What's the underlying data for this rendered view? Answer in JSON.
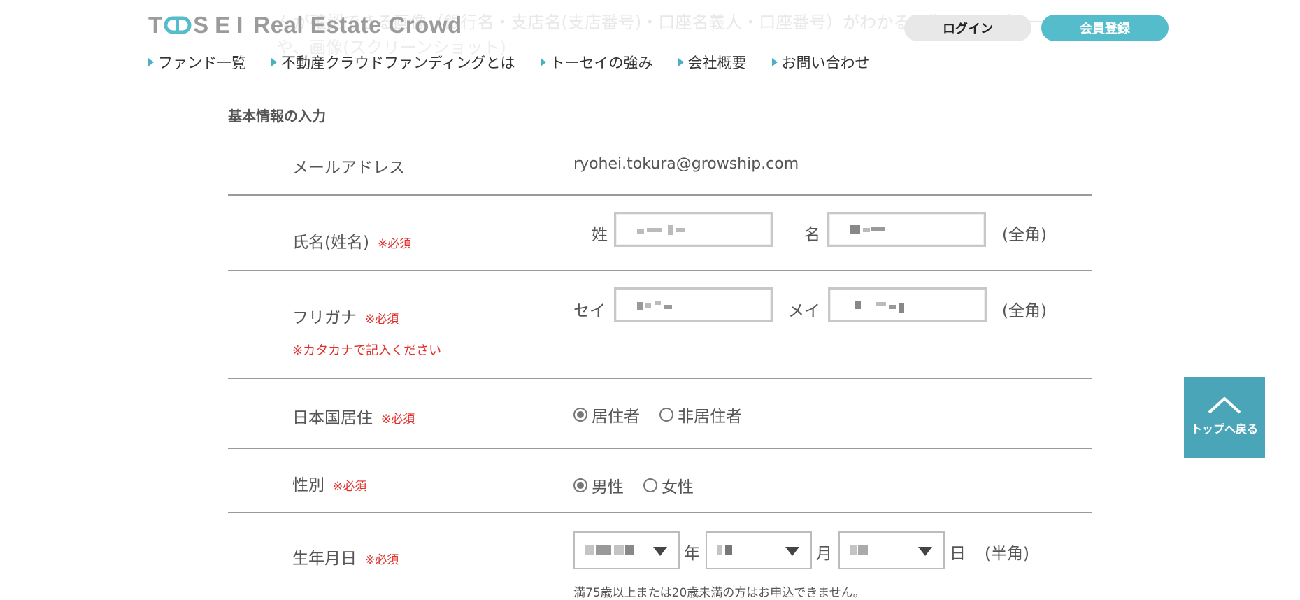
{
  "header": {
    "logo": "TOSEI Real Estate Crowd",
    "logo_parts": {
      "t": "T",
      "sei": "SEI",
      "rest": "Real Estate Crowd"
    },
    "login_label": "ログイン",
    "register_label": "会員登録",
    "nav": [
      {
        "label": "ファンド一覧"
      },
      {
        "label": "不動産クラウドファンディングとは"
      },
      {
        "label": "トーセイの強み"
      },
      {
        "label": "会社概要"
      },
      {
        "label": "お問い合わせ"
      }
    ]
  },
  "background_text": {
    "line1": "んが確認できる画像（銀行名・支店名(支店番号)・口座名義人・口座番号）がわかる画像をアップロード",
    "line2": "や、画像(スクリーンショット)"
  },
  "form": {
    "section_title": "基本情報の入力",
    "required": "※必須",
    "email": {
      "label": "メールアドレス",
      "value": "ryohei.tokura@growship.com"
    },
    "name": {
      "label": "氏名(姓名)",
      "sei_label": "姓",
      "mei_label": "名",
      "suffix": "(全角)"
    },
    "kana": {
      "label": "フリガナ",
      "note": "※カタカナで記入ください",
      "sei_label": "セイ",
      "mei_label": "メイ",
      "suffix": "(全角)"
    },
    "residence": {
      "label": "日本国居住",
      "options": [
        "居住者",
        "非居住者"
      ],
      "selected": "居住者"
    },
    "gender": {
      "label": "性別",
      "options": [
        "男性",
        "女性"
      ],
      "selected": "男性"
    },
    "birthdate": {
      "label": "生年月日",
      "year_unit": "年",
      "month_unit": "月",
      "day_unit": "日",
      "suffix": "(半角)",
      "note": "満75歳以上または20歳未満の方はお申込できません。"
    }
  },
  "back_to_top": {
    "label": "トップへ戻る",
    "icon": "chevron-up-icon"
  },
  "colors": {
    "accent": "#55bccb",
    "required": "#e0312d",
    "totop_bg": "#4ba5b8"
  }
}
